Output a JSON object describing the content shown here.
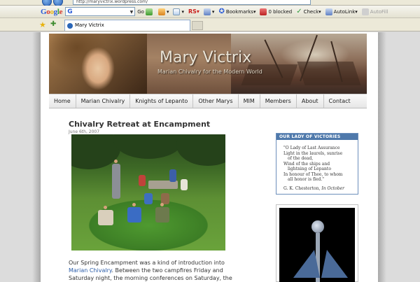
{
  "browser": {
    "address": "http://maryvictrix.wordpress.com/",
    "toolbar": {
      "search_prefix": "G",
      "go_label": "Go",
      "rs_label": "RS",
      "bookmarks_label": "Bookmarks",
      "blocked_label": "0 blocked",
      "check_label": "Check",
      "autolink_label": "AutoLink",
      "autofill_label": "AutoFill"
    },
    "tab": {
      "title": "Mary Victrix"
    }
  },
  "site": {
    "title": "Mary Victrix",
    "tagline": "Marian Chivalry for the Modern World"
  },
  "menu": {
    "items": [
      "Home",
      "Marian Chivalry",
      "Knights of Lepanto",
      "Other Marys",
      "MIM",
      "Members",
      "About",
      "Contact"
    ]
  },
  "post": {
    "title": "Chivalry Retreat at Encampment",
    "date": "June 6th, 2007",
    "text_before_link": "Our Spring Encampment was a kind of introduction into ",
    "link_text": "Marian Chivalry",
    "text_after_link": ". Between the two campfires Friday and Saturday night, the morning conferences on Saturday, the Mass homilies and the little"
  },
  "sidebar": {
    "widget_title": "OUR LADY OF VICTORIES",
    "poem_lines": [
      "\"O Lady of Last Assurance",
      "Light in the laurels, sunrise",
      "of the dead,",
      "Wind of the ships and",
      "lightning of Lepanto",
      "In honour of Thee, to whom",
      "all honor is fled.\""
    ],
    "signature_author": "G. K. Chesterton,",
    "signature_work": "In October"
  }
}
